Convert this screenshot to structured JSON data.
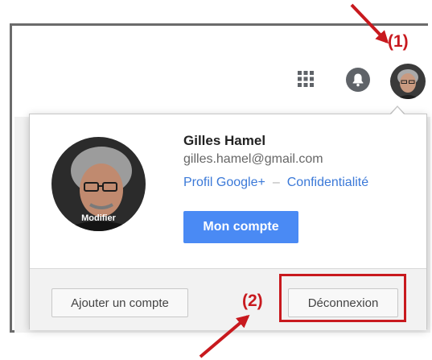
{
  "topbar": {
    "apps_icon": "apps-grid-icon",
    "notifications_icon": "bell-icon",
    "avatar_icon": "user-avatar"
  },
  "account": {
    "name": "Gilles Hamel",
    "email": "gilles.hamel@gmail.com",
    "profile_link": "Profil Google+",
    "separator": "–",
    "privacy_link": "Confidentialité",
    "modify_label": "Modifier",
    "account_button": "Mon compte"
  },
  "footer": {
    "add_account": "Ajouter un compte",
    "logout": "Déconnexion"
  },
  "annotations": {
    "label_1": "(1)",
    "label_2": "(2)",
    "color": "#c8191e"
  },
  "colors": {
    "primary_button": "#4a8af4",
    "link": "#3b79d8"
  }
}
